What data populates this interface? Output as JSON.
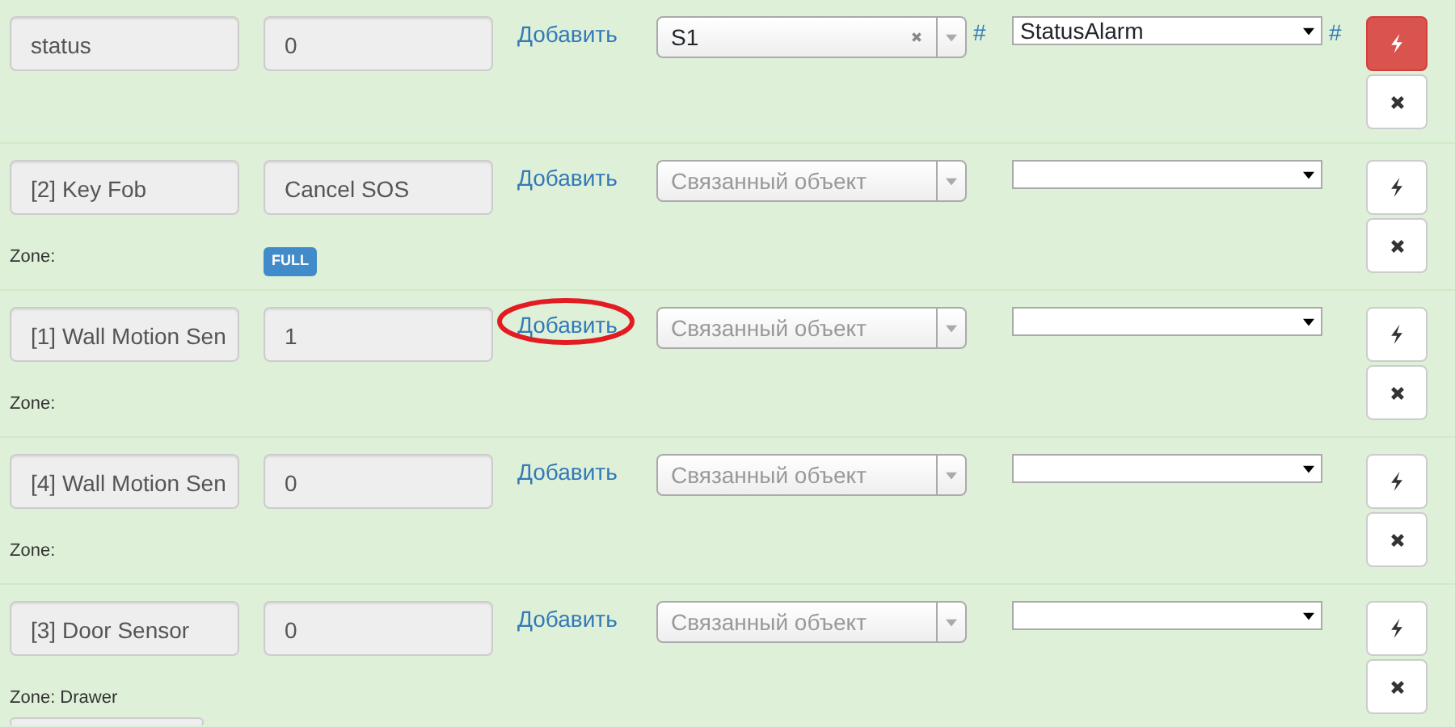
{
  "rows": [
    {
      "name": "status",
      "value": "0",
      "add_link": "Добавить",
      "circled": false,
      "linked": {
        "value": "S1",
        "clearable": true
      },
      "linked_hash": "#",
      "field": "StatusAlarm",
      "field_hash": "#",
      "trigger_active": true,
      "trailing_field": false
    },
    {
      "name": "[2] Key Fob",
      "value": "Cancel SOS",
      "add_link": "Добавить",
      "circled": false,
      "linked": {
        "placeholder": "Связанный объект",
        "clearable": false
      },
      "trigger_active": false,
      "zone": "Zone:",
      "badge": "FULL",
      "trailing_field": false
    },
    {
      "name": "[1] Wall Motion Sen",
      "value": "1",
      "add_link": "Добавить",
      "circled": true,
      "linked": {
        "placeholder": "Связанный объект",
        "clearable": false
      },
      "trigger_active": false,
      "zone": "Zone:",
      "trailing_field": false
    },
    {
      "name": "[4] Wall Motion Sen",
      "value": "0",
      "add_link": "Добавить",
      "circled": false,
      "linked": {
        "placeholder": "Связанный объект",
        "clearable": false
      },
      "trigger_active": false,
      "zone": "Zone:",
      "trailing_field": false
    },
    {
      "name": "[3] Door Sensor",
      "value": "0",
      "add_link": "Добавить",
      "circled": false,
      "linked": {
        "placeholder": "Связанный объект",
        "clearable": false
      },
      "trigger_active": false,
      "zone": "Zone: Drawer",
      "trailing_field": true
    }
  ]
}
